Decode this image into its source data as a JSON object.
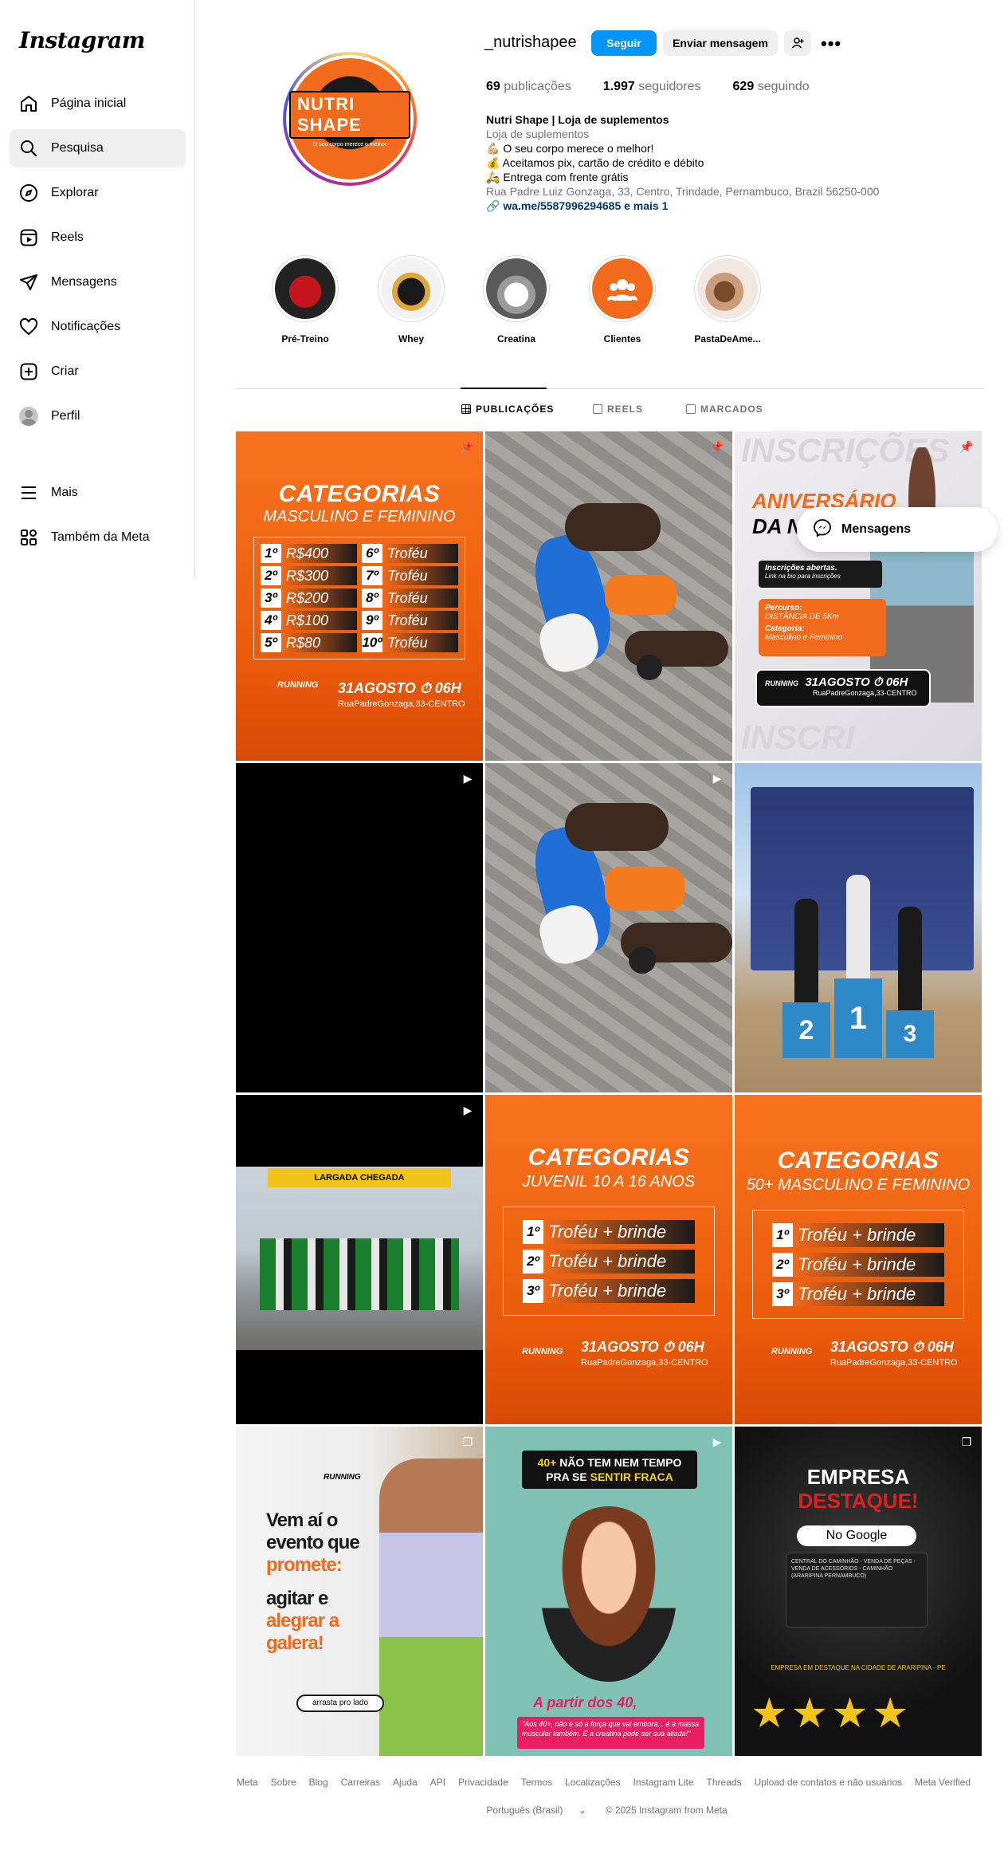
{
  "sidebar": {
    "logo": "Instagram",
    "items": [
      {
        "label": "Página inicial",
        "icon": "home-icon"
      },
      {
        "label": "Pesquisa",
        "icon": "search-icon"
      },
      {
        "label": "Explorar",
        "icon": "compass-icon"
      },
      {
        "label": "Reels",
        "icon": "reels-icon"
      },
      {
        "label": "Mensagens",
        "icon": "paper-plane-icon"
      },
      {
        "label": "Notificações",
        "icon": "heart-icon"
      },
      {
        "label": "Criar",
        "icon": "plus-square-icon"
      },
      {
        "label": "Perfil",
        "icon": "avatar-icon"
      },
      {
        "label": "Mais",
        "icon": "menu-icon"
      },
      {
        "label": "Também da Meta",
        "icon": "meta-apps-icon"
      }
    ]
  },
  "profile": {
    "username": "_nutrishapee",
    "follow_label": "Seguir",
    "message_label": "Enviar mensagem",
    "pic_text": "NUTRI SHAPE",
    "pic_subtext": "O seu corpo merece o melhor",
    "stats": {
      "posts_count": "69",
      "posts_label": "publicações",
      "followers_count": "1.997",
      "followers_label": "seguidores",
      "following_count": "629",
      "following_label": "seguindo"
    },
    "bio": {
      "name": "Nutri Shape | Loja de suplementos",
      "category": "Loja de suplementos",
      "line1": "💪🏼 O seu corpo merece o melhor!",
      "line2": "💰 Aceitamos pix, cartão de crédito e débito",
      "line3": "🛵 Entrega com frente grátis",
      "address": "Rua Padre Luiz Gonzaga, 33, Centro, Trindade, Pernambuco, Brazil 56250-000",
      "link": "wa.me/5587996294685 e mais 1"
    }
  },
  "highlights": [
    {
      "label": "Pré-Treino"
    },
    {
      "label": "Whey"
    },
    {
      "label": "Creatina"
    },
    {
      "label": "Clientes"
    },
    {
      "label": "PastaDeAme..."
    }
  ],
  "tabs": [
    {
      "label": "PUBLICAÇÕES"
    },
    {
      "label": "REELS"
    },
    {
      "label": "MARCADOS"
    }
  ],
  "posts": {
    "p1": {
      "title": "CATEGORIAS",
      "subtitle": "MASCULINO E FEMININO",
      "rows": [
        {
          "a_place": "1º",
          "a_prize": "R$400",
          "b_place": "6º",
          "b_prize": "Troféu"
        },
        {
          "a_place": "2º",
          "a_prize": "R$300",
          "b_place": "7º",
          "b_prize": "Troféu"
        },
        {
          "a_place": "3º",
          "a_prize": "R$200",
          "b_place": "8º",
          "b_prize": "Troféu"
        },
        {
          "a_place": "4º",
          "a_prize": "R$100",
          "b_place": "9º",
          "b_prize": "Troféu"
        },
        {
          "a_place": "5º",
          "a_prize": "R$80",
          "b_place": "10º",
          "b_prize": "Troféu"
        }
      ],
      "date": "31AGOSTO",
      "time": "06H",
      "address": "RuaPadreGonzaga,33-CENTRO",
      "brand": "RUNNING"
    },
    "p3": {
      "top": "INSCRIÇÕES",
      "headline": "ANIVERSÁRIO",
      "sub": "DA NU",
      "info1": "Inscrições abertas.",
      "info1b": "Link na bio para inscrições",
      "info2": "Percurso:",
      "info2b": "DISTÂNCIA DE 5Km",
      "info3": "Categoria:",
      "info3b": "Masculino e Feminino",
      "date": "31AGOSTO",
      "time": "06H",
      "address": "RuaPadreGonzaga,33-CENTRO",
      "brand": "RUNNING",
      "bottom": "INSCRI"
    },
    "p8": {
      "title": "CATEGORIAS",
      "subtitle": "JUVENIL 10 A 16 ANOS",
      "rows": [
        {
          "place": "1º",
          "prize": "Troféu + brinde"
        },
        {
          "place": "2º",
          "prize": "Troféu + brinde"
        },
        {
          "place": "3º",
          "prize": "Troféu + brinde"
        }
      ],
      "date": "31AGOSTO",
      "time": "06H",
      "address": "RuaPadreGonzaga,33-CENTRO",
      "brand": "RUNNING"
    },
    "p9": {
      "title": "CATEGORIAS",
      "subtitle": "50+ MASCULINO E FEMININO",
      "rows": [
        {
          "place": "1º",
          "prize": "Troféu + brinde"
        },
        {
          "place": "2º",
          "prize": "Troféu + brinde"
        },
        {
          "place": "3º",
          "prize": "Troféu + brinde"
        }
      ],
      "date": "31AGOSTO",
      "time": "06H",
      "address": "RuaPadreGonzaga,33-CENTRO",
      "brand": "RUNNING"
    },
    "p7": {
      "banner": "LARGADA CHEGADA"
    },
    "p10": {
      "brand": "RUNNING",
      "line1": "Vem aí o",
      "line2": "evento que",
      "line3": "promete:",
      "line4": "agitar e",
      "line5": "alegrar a",
      "line6": "galera!",
      "button": "arrasta pro lado"
    },
    "p11": {
      "top1": "40+",
      "top2": "NÃO TEM NEM TEMPO",
      "top3": "PRA SE",
      "top4": "SENTIR FRACA",
      "bottom": "A partir dos 40,",
      "caption": "\"Aos 40+, não é só a força que vai embora... é a massa muscular também. E a creatina pode ser sua aliada!\""
    },
    "p12": {
      "title1": "EMPRESA",
      "title2": "DESTAQUE!",
      "google": "No Google",
      "card_text": "CENTRAL DO CAMINHÃO - VENDA DE PEÇAS - VENDA DE ACESSÓRIOS - CAMINHÃO (ARARIPINA PERNAMBUCO)",
      "caption": "EMPRESA EM DESTAQUE NA CIDADE DE ARARIPINA - PE"
    }
  },
  "messages_popup": {
    "label": "Mensagens"
  },
  "footer": {
    "links": [
      "Meta",
      "Sobre",
      "Blog",
      "Carreiras",
      "Ajuda",
      "API",
      "Privacidade",
      "Termos",
      "Localizações",
      "Instagram Lite",
      "Threads",
      "Upload de contatos e não usuários",
      "Meta Verified"
    ],
    "language": "Português (Brasil)",
    "copyright": "© 2025 Instagram from Meta"
  }
}
